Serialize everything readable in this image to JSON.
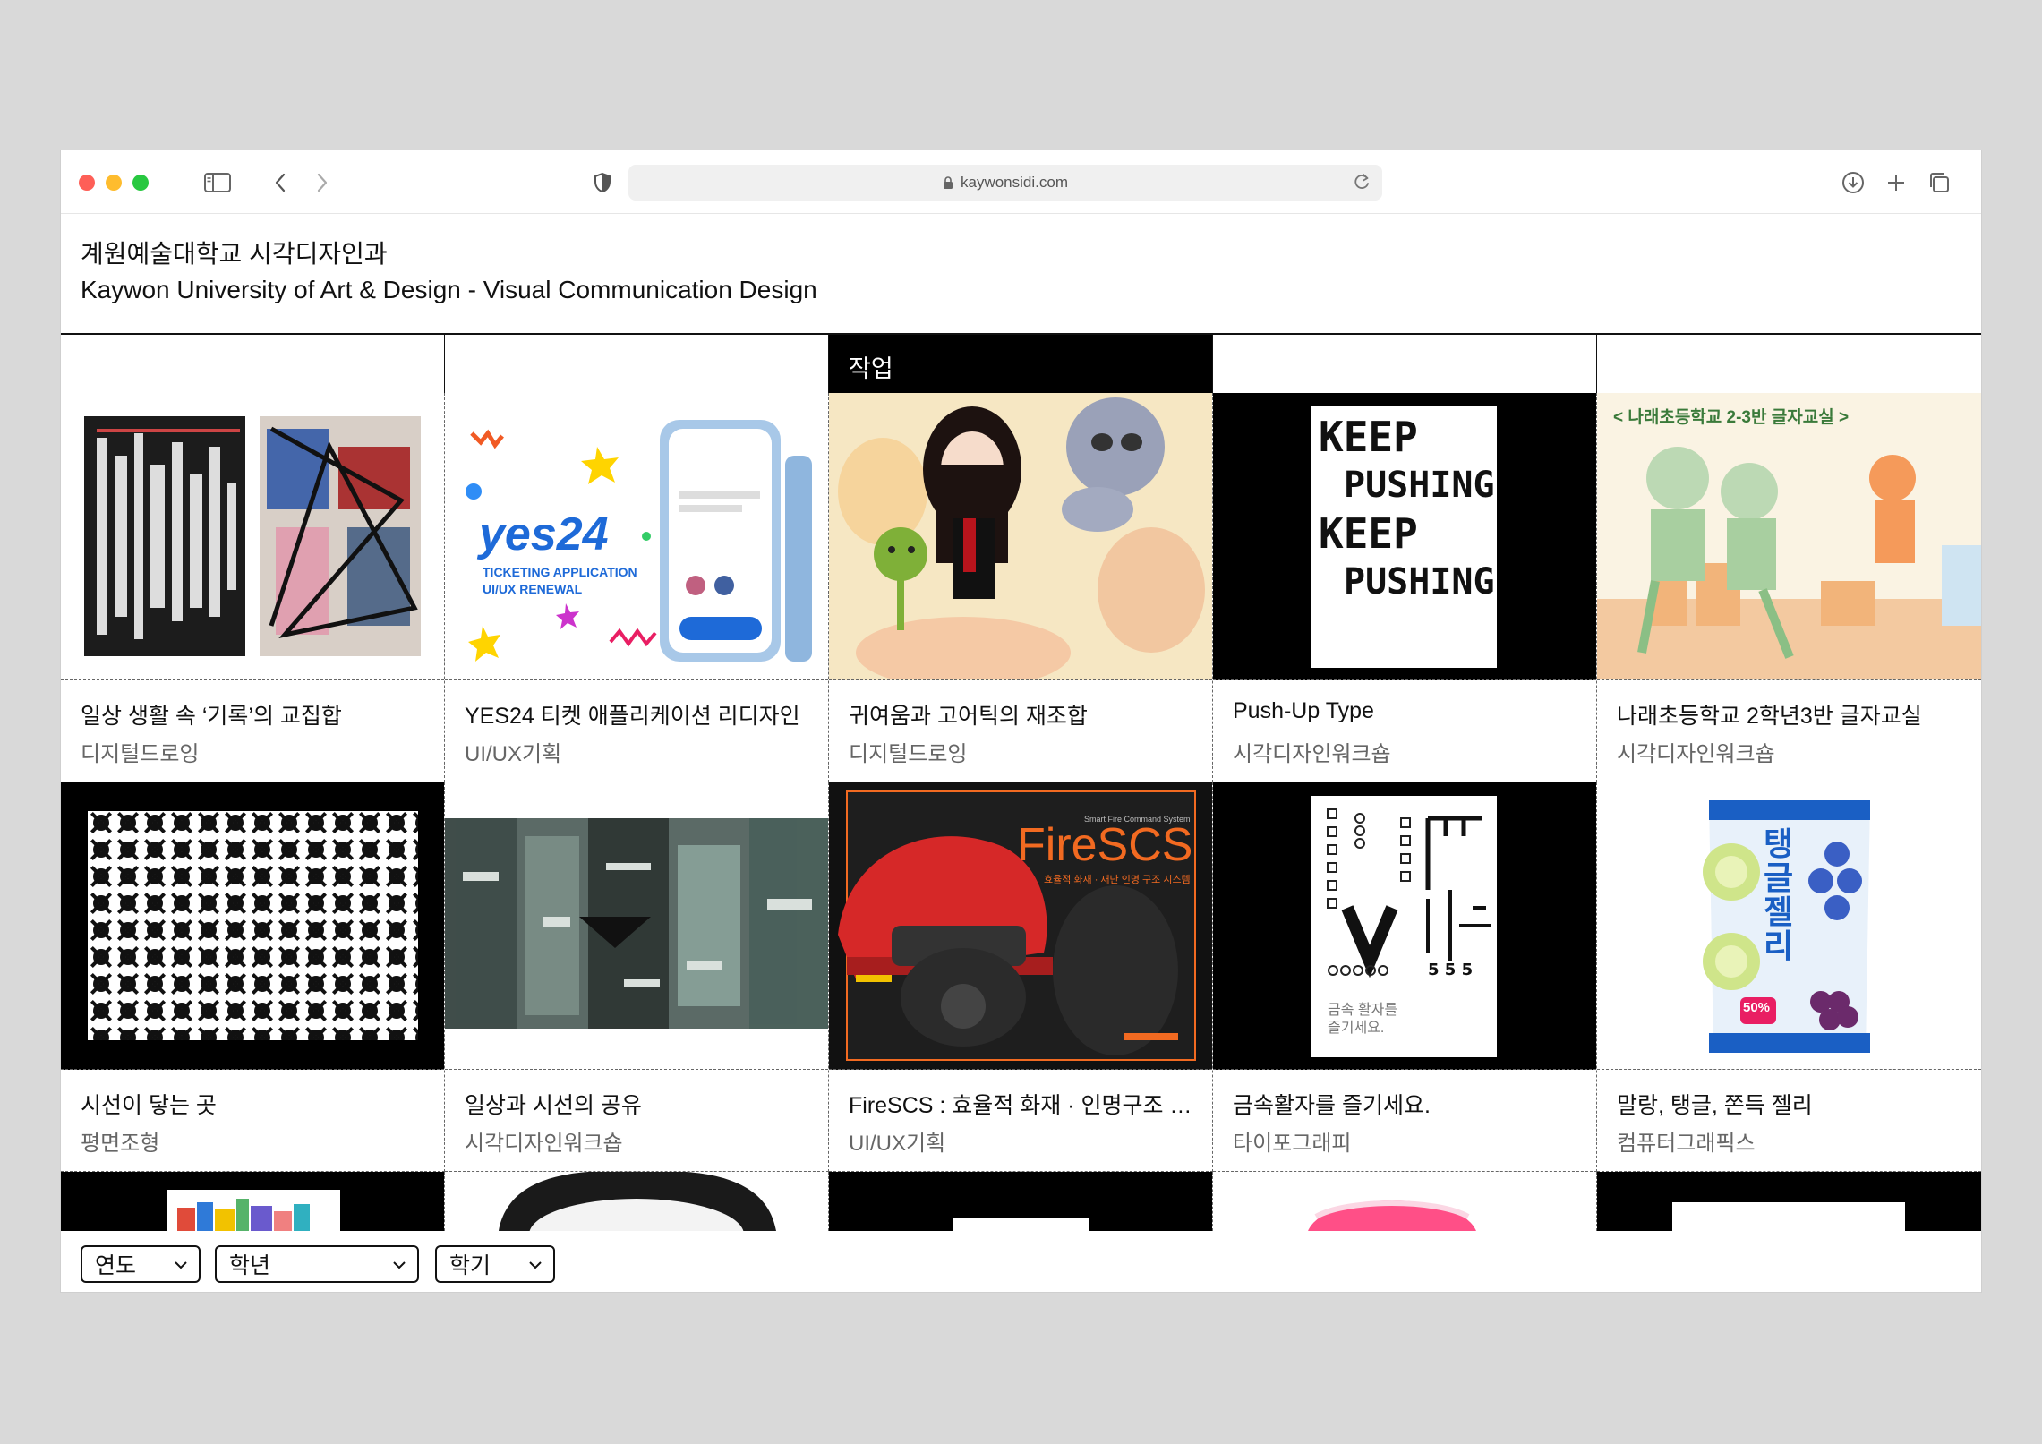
{
  "browser": {
    "url": "kaywonsidi.com"
  },
  "header": {
    "title_ko": "계원예술대학교 시각디자인과",
    "title_en": "Kaywon University of Art & Design - Visual Communication Design"
  },
  "nav": {
    "cells": [
      "",
      "",
      "작업",
      "",
      ""
    ],
    "active_index": 2
  },
  "cards": [
    {
      "title": "일상 생활 속 ‘기록’의 교집합",
      "category": "디지털드로잉"
    },
    {
      "title": "YES24 티켓 애플리케이션 리디자인",
      "category": "UI/UX기획"
    },
    {
      "title": "귀여움과 고어틱의 재조합",
      "category": "디지털드로잉"
    },
    {
      "title": "Push-Up Type",
      "category": "시각디자인워크숍"
    },
    {
      "title": "나래초등학교 2학년3반 글자교실",
      "category": "시각디자인워크숍"
    },
    {
      "title": "시선이 닿는 곳",
      "category": "평면조형"
    },
    {
      "title": "일상과 시선의 공유",
      "category": "시각디자인워크숍"
    },
    {
      "title": "FireSCS : 효율적 화재 · 인명구조 시스템",
      "category": "UI/UX기획"
    },
    {
      "title": "금속활자를 즐기세요.",
      "category": "타이포그래피"
    },
    {
      "title": "말랑, 탱글, 쫀득 젤리",
      "category": "컴퓨터그래픽스"
    }
  ],
  "thumb_text": {
    "yes24_logo": "yes24",
    "yes24_sub1": "TICKETING APPLICATION",
    "yes24_sub2": "UI/UX RENEWAL",
    "keep": "KEEP",
    "pushing": "PUSHING",
    "narae_banner": "< 나래초등학교 2-3반 글자교실 >",
    "firescs_logo": "FireSCS",
    "firescs_small": "Smart Fire Command System",
    "firescs_sub": "효율적 화재 · 재난 인명 구조 시스템",
    "metal_caption": "금속 활자를 즐기세요.",
    "jelly_name": "탱글젤리",
    "jelly_pct": "50%"
  },
  "filters": {
    "year": "연도",
    "grade": "학년",
    "semester": "학기"
  },
  "colors": {
    "accent_black": "#000000",
    "firescs_orange": "#f26a21",
    "yes24_blue": "#1e6ad8",
    "jelly_blue": "#1a5fc4"
  }
}
